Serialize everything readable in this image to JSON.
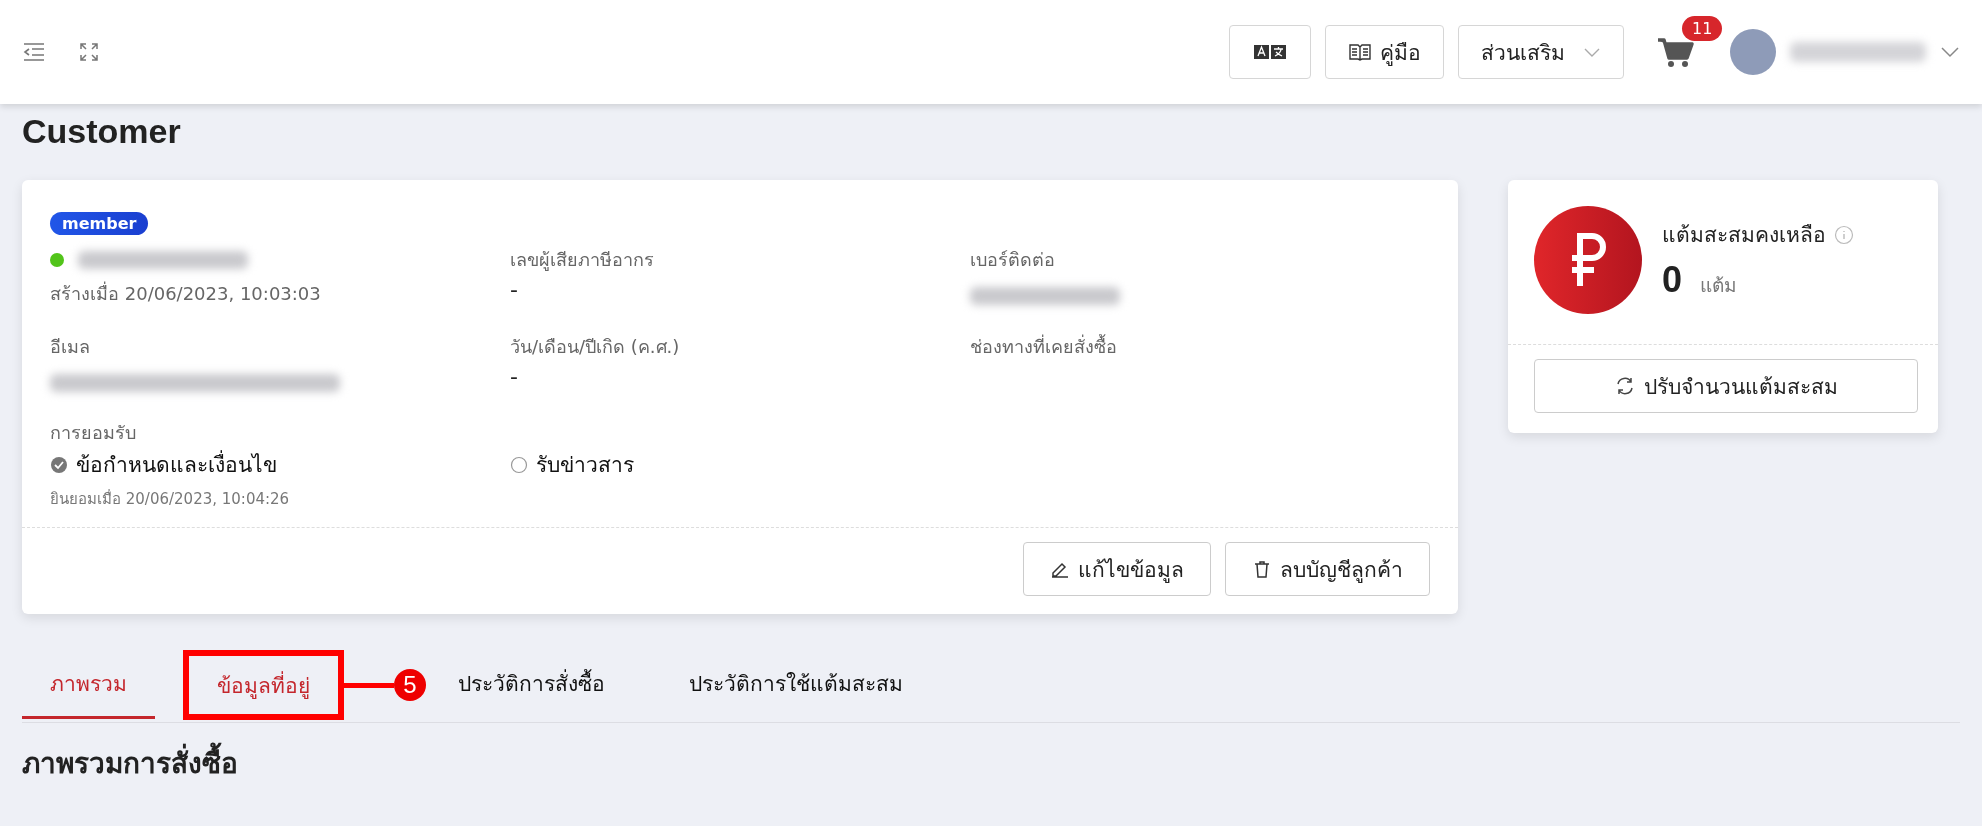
{
  "topbar": {
    "buttons": [
      {
        "kind": "translate"
      },
      {
        "kind": "manual",
        "label": "คู่มือ"
      },
      {
        "kind": "dropdown",
        "label": "ส่วนเสริม"
      }
    ],
    "cart_count": "11"
  },
  "page_title": "Customer",
  "customer": {
    "badge": "member",
    "created": "สร้างเมื่อ 20/06/2023, 10:03:03",
    "fields": [
      {
        "label": "เลขผู้เสียภาษีอากร",
        "value": "-"
      },
      {
        "label": "เบอร์ติดต่อ",
        "blurred": true
      },
      {
        "label": "อีเมล",
        "blurred": true
      },
      {
        "label": "วัน/เดือน/ปีเกิด (ค.ศ.)",
        "value": "-"
      },
      {
        "label": "ช่องทางที่เคยสั่งซื้อ"
      }
    ],
    "consent_label": "การยอมรับ",
    "consents": [
      {
        "label": "ข้อกำหนดและเงื่อนไข",
        "checked": true,
        "note": "ยินยอมเมื่อ 20/06/2023, 10:04:26"
      },
      {
        "label": "รับข่าวสาร",
        "checked": false
      }
    ],
    "actions": [
      {
        "kind": "edit",
        "label": "แก้ไขข้อมูล"
      },
      {
        "kind": "delete",
        "label": "ลบบัญชีลูกค้า"
      }
    ]
  },
  "points": {
    "title": "แต้มสะสมคงเหลือ",
    "value": "0",
    "unit": "แต้ม",
    "button": "ปรับจำนวนแต้มสะสม"
  },
  "tabs": [
    {
      "label": "ภาพรวม",
      "selected": true,
      "annotated": false
    },
    {
      "label": "ข้อมูลที่อยู่",
      "selected": false,
      "annotated": true
    },
    {
      "label": "ประวัติการสั่งซื้อ",
      "selected": false,
      "annotated": false
    },
    {
      "label": "ประวัติการใช้แต้มสะสม",
      "selected": false,
      "annotated": false
    }
  ],
  "annotation_number": "5",
  "section_title": "ภาพรวมการสั่งซื้อ"
}
